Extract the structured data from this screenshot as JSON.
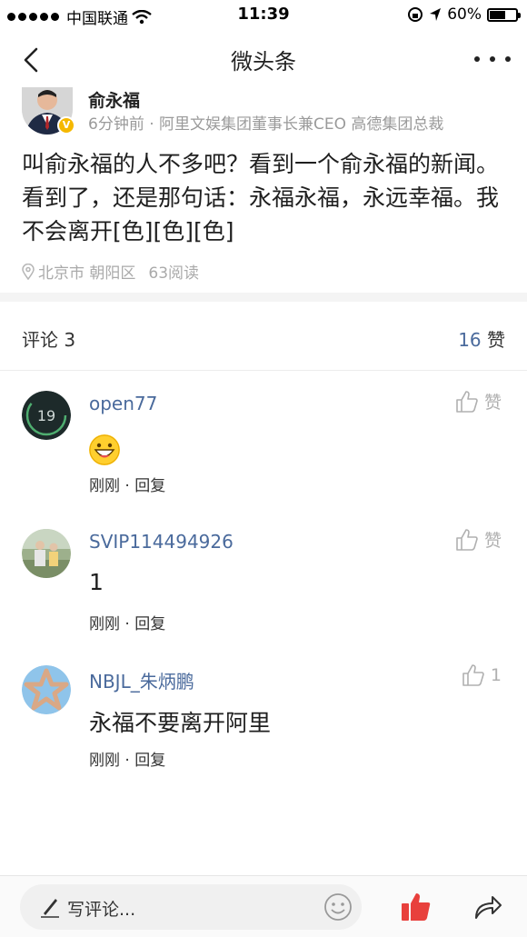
{
  "status_bar": {
    "carrier": "中国联通",
    "time": "11:39",
    "battery": "60%",
    "battery_level": 0.6
  },
  "nav": {
    "title": "微头条"
  },
  "post": {
    "author": "俞永福",
    "meta": "6分钟前 · 阿里文娱集团董事长兼CEO 高德集团总裁",
    "text": "叫俞永福的人不多吧？看到一个俞永福的新闻。看到了，还是那句话：永福永福，永远幸福。我不会离开[色][色][色]",
    "location": "北京市 朝阳区",
    "reads": "63阅读"
  },
  "comments_header": {
    "label": "评论 3",
    "likes_count": "16",
    "likes_label": "赞"
  },
  "comments": [
    {
      "user": "open77",
      "avatar_text": "19",
      "body": "",
      "has_emoji": true,
      "like_label": "赞",
      "meta": "刚刚 · 回复"
    },
    {
      "user": "SVIP114494926",
      "body": "1",
      "like_label": "赞",
      "meta": "刚刚 · 回复"
    },
    {
      "user": "NBJL_朱炳鹏",
      "body": "永福不要离开阿里",
      "like_label": "1",
      "meta": "刚刚 · 回复"
    }
  ],
  "bottom_bar": {
    "input_placeholder": "写评论..."
  },
  "colors": {
    "link_blue": "#4a6a9c",
    "like_red": "#e8403c",
    "badge_yellow": "#f5b800"
  },
  "icons": [
    "back-icon",
    "more-icon",
    "location-pin-icon",
    "thumb-up-icon",
    "pen-icon",
    "smile-icon",
    "like-filled-icon",
    "share-icon",
    "wifi-icon",
    "location-arrow-icon",
    "rotation-lock-icon"
  ]
}
